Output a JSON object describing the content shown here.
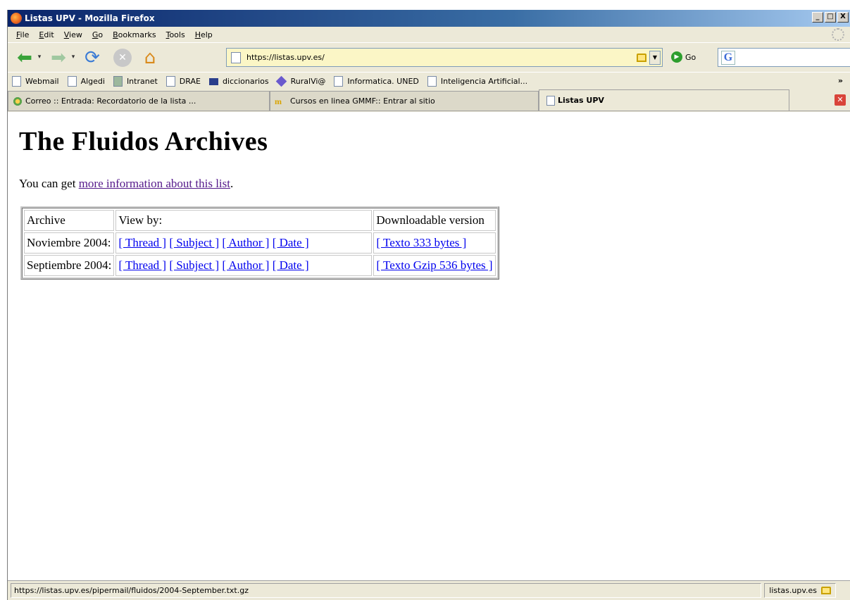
{
  "window": {
    "title": "Listas UPV - Mozilla Firefox",
    "controls": {
      "minimize": "_",
      "maximize": "□",
      "close": "X"
    }
  },
  "menu": [
    "File",
    "Edit",
    "View",
    "Go",
    "Bookmarks",
    "Tools",
    "Help"
  ],
  "nav": {
    "url": "https://listas.upv.es/",
    "go_label": "Go",
    "search_value": ""
  },
  "bookmarks": [
    {
      "label": "Webmail",
      "icon": "page-icon"
    },
    {
      "label": "Algedi",
      "icon": "page-icon"
    },
    {
      "label": "Intranet",
      "icon": "intranet-icon"
    },
    {
      "label": "DRAE",
      "icon": "page-icon"
    },
    {
      "label": "diccionarios",
      "icon": "folder-icon"
    },
    {
      "label": "RuralVi@",
      "icon": "diamond-icon"
    },
    {
      "label": "Informatica. UNED",
      "icon": "page-icon"
    },
    {
      "label": "Inteligencia Artificial...",
      "icon": "page-icon"
    }
  ],
  "bookmarks_overflow": "»",
  "tabs": [
    {
      "label": "Correo :: Entrada: Recordatorio de la lista ...",
      "active": false
    },
    {
      "label": "Cursos en linea GMMF:: Entrar al sitio",
      "active": false
    },
    {
      "label": "Listas UPV",
      "active": true
    }
  ],
  "page": {
    "heading": "The Fluidos Archives",
    "intro_prefix": "You can get ",
    "intro_link": "more information about this list",
    "intro_suffix": ".",
    "table": {
      "headers": [
        "Archive",
        "View by:",
        "Downloadable version"
      ],
      "rows": [
        {
          "archive": "Noviembre 2004:",
          "thread": "[ Thread ]",
          "subject": "[ Subject ]",
          "author": "[ Author ]",
          "date": "[ Date ]",
          "download": "[ Texto 333 bytes ]"
        },
        {
          "archive": "Septiembre 2004:",
          "thread": "[ Thread ]",
          "subject": "[ Subject ]",
          "author": "[ Author ]",
          "date": "[ Date ]",
          "download": "[ Texto Gzip 536 bytes ]"
        }
      ]
    }
  },
  "status": {
    "text": "https://listas.upv.es/pipermail/fluidos/2004-September.txt.gz",
    "host": "listas.upv.es"
  }
}
